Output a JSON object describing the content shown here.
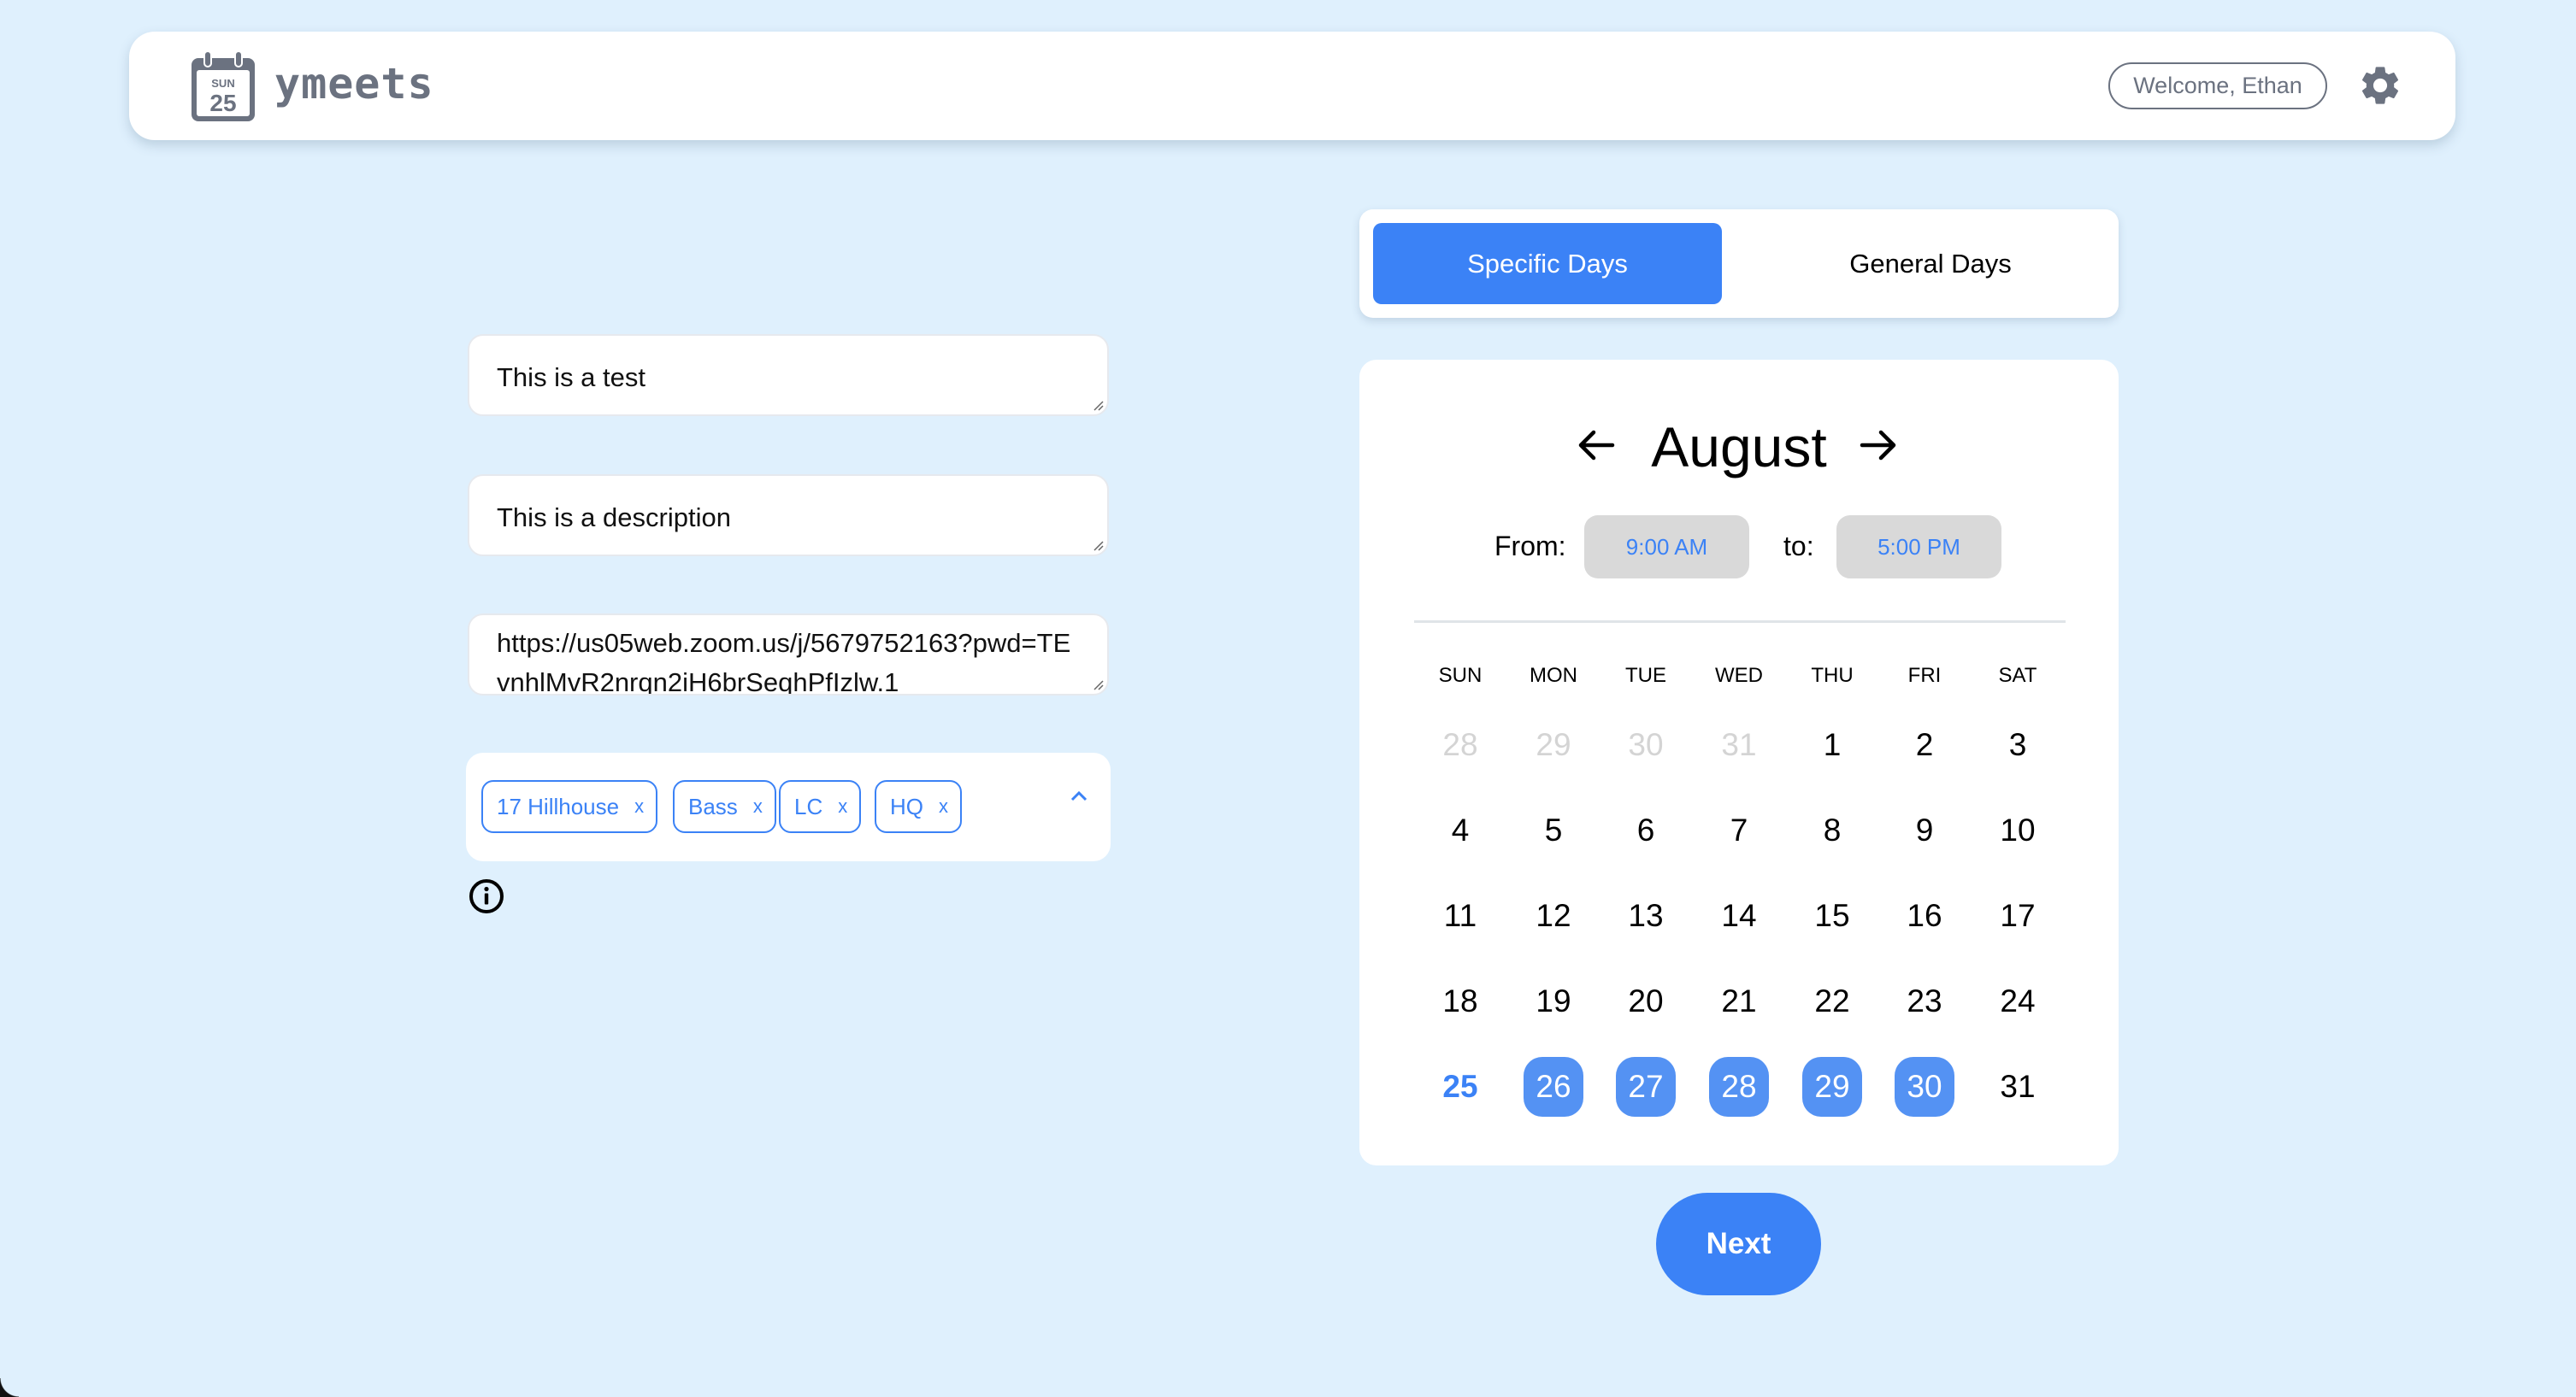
{
  "header": {
    "logo": {
      "icon": "calendar-icon",
      "day_abbr": "SUN",
      "day_num": "25"
    },
    "app_name": "ymeets",
    "welcome": "Welcome, Ethan",
    "settings_icon": "gear-icon"
  },
  "form": {
    "title_value": "This is a test",
    "description_value": "This is a description",
    "link_value": "https://us05web.zoom.us/j/5679752163?pwd=TEvnhlMvR2nrqn2iH6brSeqhPfIzlw.1",
    "locations": {
      "tags": [
        "17 Hillhouse",
        "Bass",
        "LC",
        "HQ"
      ],
      "remove_glyph": "x",
      "toggle_icon": "chevron-up-icon"
    },
    "info_icon": "info-icon"
  },
  "mode_tabs": [
    {
      "label": "Specific Days",
      "active": true
    },
    {
      "label": "General Days",
      "active": false
    }
  ],
  "calendar": {
    "month": "August",
    "prev_icon": "arrow-left-icon",
    "next_icon": "arrow-right-icon",
    "from_label": "From:",
    "from_value": "9:00 AM",
    "to_label": "to:",
    "to_value": "5:00 PM",
    "weekdays": [
      "SUN",
      "MON",
      "TUE",
      "WED",
      "THU",
      "FRI",
      "SAT"
    ],
    "weeks": [
      [
        {
          "d": "28",
          "s": "muted"
        },
        {
          "d": "29",
          "s": "muted"
        },
        {
          "d": "30",
          "s": "muted"
        },
        {
          "d": "31",
          "s": "muted"
        },
        {
          "d": "1",
          "s": ""
        },
        {
          "d": "2",
          "s": ""
        },
        {
          "d": "3",
          "s": ""
        }
      ],
      [
        {
          "d": "4",
          "s": ""
        },
        {
          "d": "5",
          "s": ""
        },
        {
          "d": "6",
          "s": ""
        },
        {
          "d": "7",
          "s": ""
        },
        {
          "d": "8",
          "s": ""
        },
        {
          "d": "9",
          "s": ""
        },
        {
          "d": "10",
          "s": ""
        }
      ],
      [
        {
          "d": "11",
          "s": ""
        },
        {
          "d": "12",
          "s": ""
        },
        {
          "d": "13",
          "s": ""
        },
        {
          "d": "14",
          "s": ""
        },
        {
          "d": "15",
          "s": ""
        },
        {
          "d": "16",
          "s": ""
        },
        {
          "d": "17",
          "s": ""
        }
      ],
      [
        {
          "d": "18",
          "s": ""
        },
        {
          "d": "19",
          "s": ""
        },
        {
          "d": "20",
          "s": ""
        },
        {
          "d": "21",
          "s": ""
        },
        {
          "d": "22",
          "s": ""
        },
        {
          "d": "23",
          "s": ""
        },
        {
          "d": "24",
          "s": ""
        }
      ],
      [
        {
          "d": "25",
          "s": "today"
        },
        {
          "d": "26",
          "s": "selected"
        },
        {
          "d": "27",
          "s": "selected"
        },
        {
          "d": "28",
          "s": "selected"
        },
        {
          "d": "29",
          "s": "selected"
        },
        {
          "d": "30",
          "s": "selected"
        },
        {
          "d": "31",
          "s": ""
        }
      ]
    ]
  },
  "next_label": "Next",
  "colors": {
    "background": "#dff0fd",
    "accent": "#3b82f6",
    "selected_day": "#5492f3",
    "muted_text": "#6b7280",
    "time_button_bg": "#d9d9d9"
  }
}
